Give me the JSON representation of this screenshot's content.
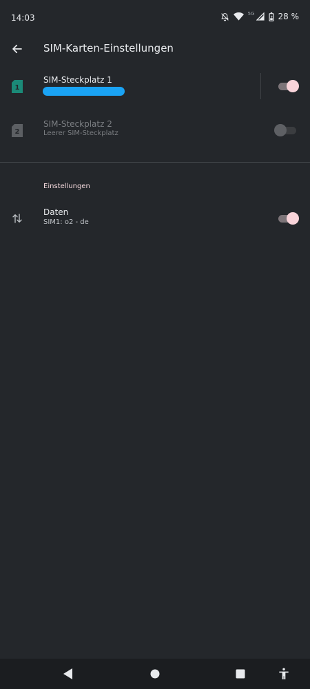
{
  "status_bar": {
    "time": "14:03",
    "network_type": "5G",
    "battery": "28 %",
    "icons": [
      "mute-alarm-icon",
      "wifi-icon",
      "signal-icon",
      "battery-icon"
    ]
  },
  "app_bar": {
    "title": "SIM-Karten-Einstellungen",
    "back_icon": "arrow-back-icon"
  },
  "sim_slots": [
    {
      "title": "SIM-Steckplatz 1",
      "subtitle_redacted": true,
      "enabled": true,
      "icon": "sim-card-icon",
      "badge": "1",
      "color": "#1b8a78"
    },
    {
      "title": "SIM-Steckplatz 2",
      "subtitle": "Leerer SIM-Steckplatz",
      "enabled": false,
      "icon": "sim-card-icon",
      "badge": "2",
      "color": "#5c5f63"
    }
  ],
  "settings": {
    "header": "Einstellungen",
    "items": [
      {
        "title": "Daten",
        "subtitle": "SIM1: o2 - de",
        "enabled": true,
        "icon": "data-transfer-icon"
      }
    ]
  },
  "nav_bar": {
    "icons": [
      "nav-back-icon",
      "nav-home-icon",
      "nav-recents-icon",
      "accessibility-icon"
    ]
  },
  "colors": {
    "background": "#24272b",
    "accent_thumb": "#f9d4da",
    "redaction": "#1aa3f4",
    "section_header": "#f3d8dc"
  }
}
